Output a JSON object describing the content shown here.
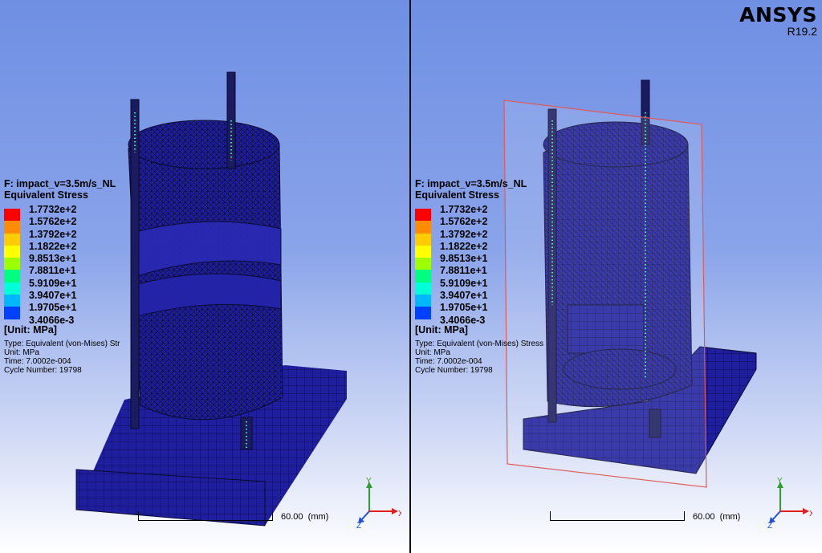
{
  "logo": {
    "name": "ANSYS",
    "version": "R19.2"
  },
  "legend": {
    "title": "F: impact_v=3.5m/s_NL",
    "subtitle": "Equivalent Stress",
    "values": [
      "1.7732e+2",
      "1.5762e+2",
      "1.3792e+2",
      "1.1822e+2",
      "9.8513e+1",
      "7.8811e+1",
      "5.9109e+1",
      "3.9407e+1",
      "1.9705e+1",
      "3.4066e-3"
    ],
    "colors": [
      "#ff0000",
      "#ff8c00",
      "#ffcc00",
      "#ffff00",
      "#9eff00",
      "#00ff80",
      "#00ffd8",
      "#00b8ff",
      "#0040ff",
      "#0000c8"
    ],
    "unit": "[Unit: MPa]",
    "type_left": "Type: Equivalent (von-Mises) Str",
    "type_right": "Type: Equivalent (von-Mises) Stress",
    "unit_line": "Unit: MPa",
    "time": "Time: 7.0002e-004",
    "cycle": "Cycle Number: 19798"
  },
  "scale": {
    "value": "60.00",
    "unit": "(mm)"
  },
  "triad": {
    "x": "X",
    "y": "Y",
    "z": "Z"
  },
  "colors": {
    "mesh_fill": "#1f1f9e",
    "mesh_line": "#0a0a30",
    "section_plane": "#e05a5a",
    "rods_highlight": "#3de0a0"
  }
}
